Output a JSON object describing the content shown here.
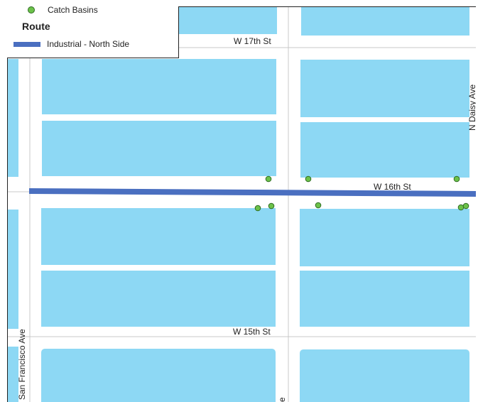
{
  "legend": {
    "catch_basins_label": "Catch Basins",
    "route_title": "Route",
    "route_label": "Industrial - North Side"
  },
  "streets": {
    "w17": "W 17th St",
    "w16": "W 16th St",
    "w15": "W 15th St",
    "n_daisy": "N Daisy Ave",
    "san_francisco": "San Francisco Ave",
    "partial_e": "e"
  },
  "colors": {
    "block": "#8dd8f4",
    "route": "#4a6fc0",
    "catch_basin": "#6cc24a",
    "street": "#ffffff"
  }
}
